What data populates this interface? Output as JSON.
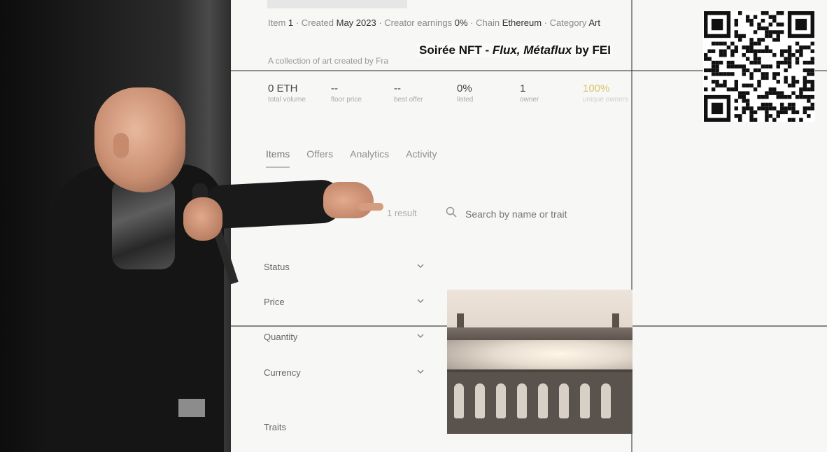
{
  "screen": {
    "meta": {
      "item_label": "Item",
      "item_value": "1",
      "created_label": "Created",
      "created_value": "May 2023",
      "earnings_label": "Creator earnings",
      "earnings_value": "0%",
      "chain_label": "Chain",
      "chain_value": "Ethereum",
      "category_label": "Category",
      "category_value": "Art"
    },
    "description": "A collection of art created by Fra",
    "stats": [
      {
        "value": "0 ETH",
        "label": "total volume"
      },
      {
        "value": "--",
        "label": "floor price"
      },
      {
        "value": "--",
        "label": "best offer"
      },
      {
        "value": "0%",
        "label": "listed"
      },
      {
        "value": "1",
        "label": "owner"
      },
      {
        "value": "100%",
        "label": "unique owners"
      }
    ],
    "tabs": [
      "Items",
      "Offers",
      "Analytics",
      "Activity"
    ],
    "result_count": "1 result",
    "search": {
      "placeholder": "Search by name or trait"
    },
    "filters": [
      "Status",
      "Price",
      "Quantity",
      "Currency",
      "Traits"
    ]
  },
  "caption": {
    "prefix": "Soirée NFT - ",
    "title": "Flux, Métaflux",
    "suffix": " by FEI"
  },
  "icons": {
    "search": "search-icon",
    "chevron": "chevron-down-icon",
    "qr": "qr-code"
  },
  "colors": {
    "accent_gold": "#d9c46a",
    "screen_bg": "#f7f7f6"
  }
}
